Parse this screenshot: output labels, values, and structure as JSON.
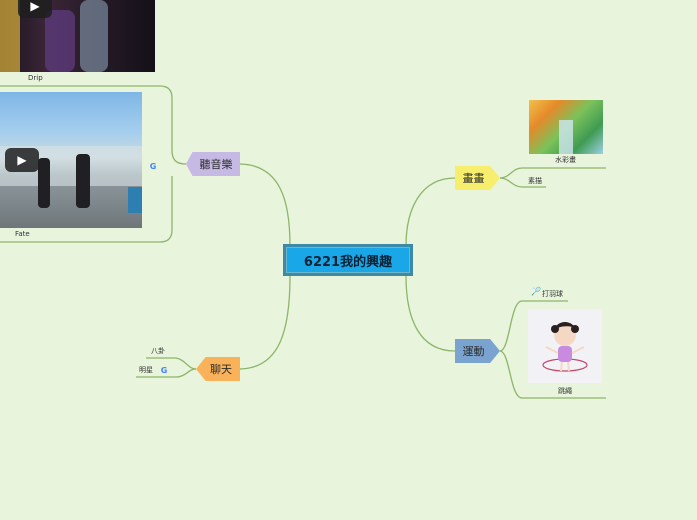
{
  "root": {
    "label": "6221我的興趣"
  },
  "branches": {
    "music": {
      "label": "聽音樂",
      "videos": [
        {
          "caption": "Drip",
          "play_icon": "play-icon"
        },
        {
          "caption": "Fate",
          "play_icon": "play-icon"
        }
      ],
      "link_icon": "google-icon"
    },
    "chat": {
      "label": "聊天",
      "items": [
        "八卦",
        "明星"
      ],
      "link_icon": "google-icon"
    },
    "draw": {
      "label": "畫畫",
      "items": [
        "水彩畫",
        "素描"
      ]
    },
    "sport": {
      "label": "運動",
      "items": [
        "打羽球",
        "跳繩"
      ]
    }
  },
  "colors": {
    "background": "#e8f4dc",
    "root": "#1aa7e8",
    "music": "#c6b9e3",
    "chat": "#f9b25a",
    "draw": "#f6ee6c",
    "sport": "#7aa3cf",
    "line": "#8cb56a"
  }
}
